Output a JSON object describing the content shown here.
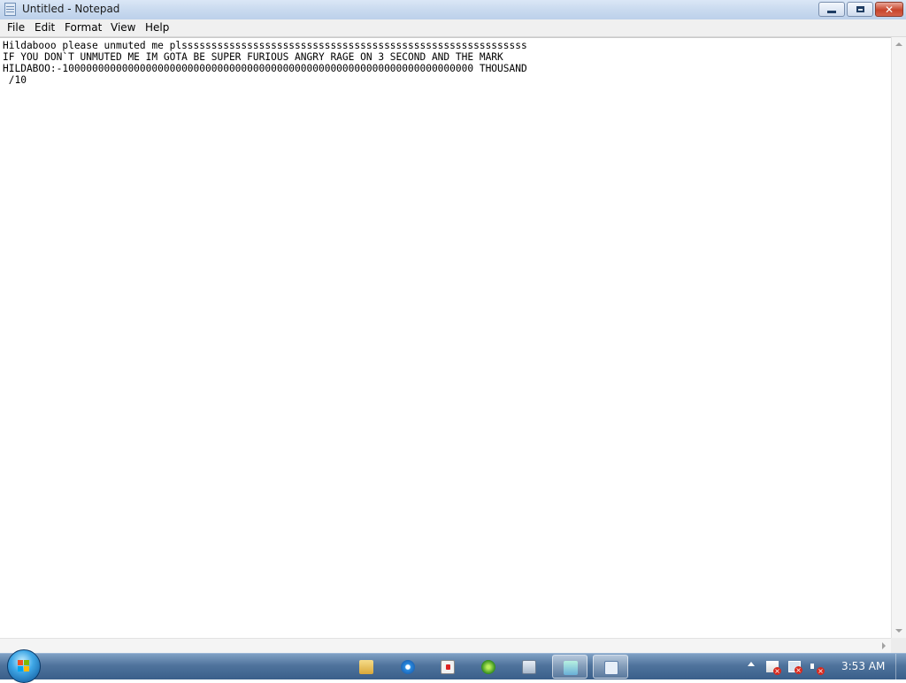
{
  "window": {
    "title": "Untitled - Notepad",
    "close_glyph": "✕"
  },
  "menu": [
    "File",
    "Edit",
    "Format",
    "View",
    "Help"
  ],
  "editor": {
    "text": "Hildabooo please unmuted me plssssssssssssssssssssssssssssssssssssssssssssssssssssssssss\nIF YOU DON`T UNMUTED ME IM GOTA BE SUPER FURIOUS ANGRY RAGE ON 3 SECOND AND THE MARK\nHILDABOO:-100000000000000000000000000000000000000000000000000000000000000000000 THOUSAND\n /10"
  },
  "taskbar": {
    "clock": "3:53 AM",
    "pinned": [
      {
        "icon": "windows-explorer-icon"
      },
      {
        "icon": "internet-explorer-icon"
      },
      {
        "icon": "windows-media-player-icon"
      },
      {
        "icon": "xbox-games-icon"
      },
      {
        "icon": "calculator-icon"
      },
      {
        "icon": "paint-icon"
      },
      {
        "icon": "notepad-icon"
      }
    ]
  },
  "colors": {
    "titlebar": "#c9daef",
    "taskbar": "#4f739c",
    "close_button": "#c8452c"
  }
}
